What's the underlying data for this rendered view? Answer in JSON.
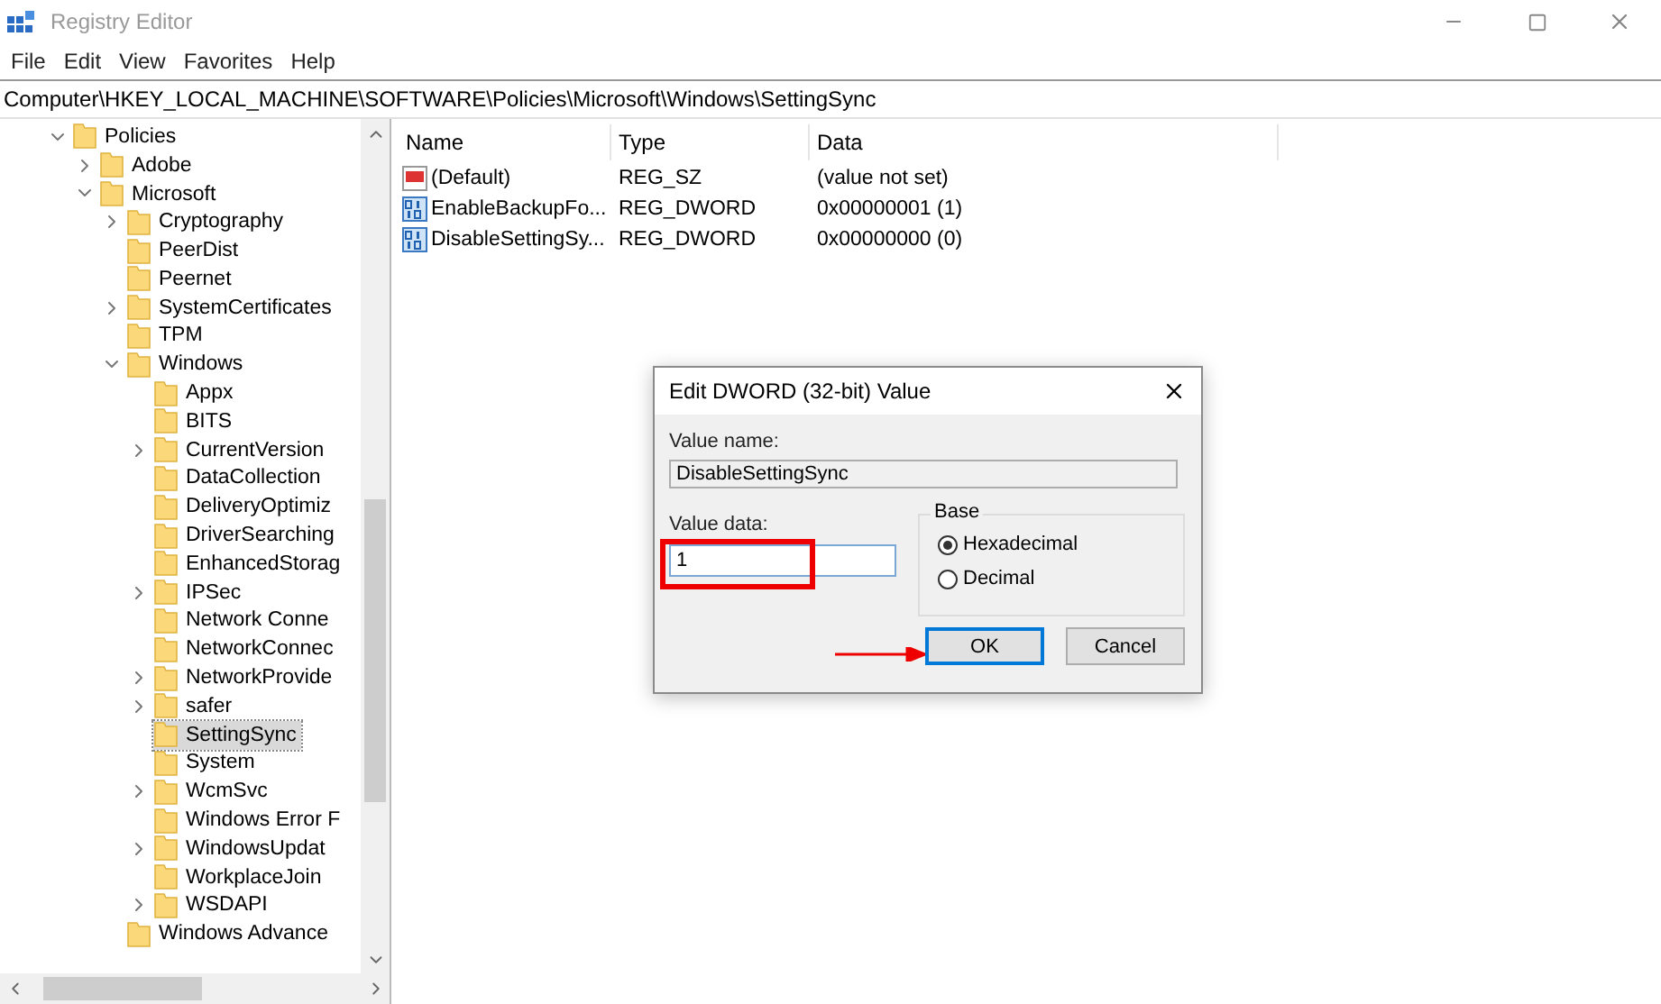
{
  "window": {
    "title": "Registry Editor"
  },
  "menu": [
    "File",
    "Edit",
    "View",
    "Favorites",
    "Help"
  ],
  "address": "Computer\\HKEY_LOCAL_MACHINE\\SOFTWARE\\Policies\\Microsoft\\Windows\\SettingSync",
  "tree": [
    {
      "label": "Policies",
      "expanded": true,
      "selected": false,
      "children": [
        {
          "label": "Adobe",
          "expanded": false,
          "selected": false
        },
        {
          "label": "Microsoft",
          "expanded": true,
          "selected": false,
          "children": [
            {
              "label": "Cryptography",
              "expanded": false,
              "selected": false
            },
            {
              "label": "PeerDist",
              "selected": false
            },
            {
              "label": "Peernet",
              "selected": false
            },
            {
              "label": "SystemCertificates",
              "expanded": false,
              "selected": false
            },
            {
              "label": "TPM",
              "selected": false
            },
            {
              "label": "Windows",
              "expanded": true,
              "selected": false,
              "children": [
                {
                  "label": "Appx",
                  "selected": false
                },
                {
                  "label": "BITS",
                  "selected": false
                },
                {
                  "label": "CurrentVersion",
                  "expanded": false,
                  "selected": false
                },
                {
                  "label": "DataCollection",
                  "selected": false
                },
                {
                  "label": "DeliveryOptimiz",
                  "selected": false
                },
                {
                  "label": "DriverSearching",
                  "selected": false
                },
                {
                  "label": "EnhancedStorag",
                  "selected": false
                },
                {
                  "label": "IPSec",
                  "expanded": false,
                  "selected": false
                },
                {
                  "label": "Network Conne",
                  "selected": false
                },
                {
                  "label": "NetworkConnec",
                  "selected": false
                },
                {
                  "label": "NetworkProvide",
                  "expanded": false,
                  "selected": false
                },
                {
                  "label": "safer",
                  "expanded": false,
                  "selected": false
                },
                {
                  "label": "SettingSync",
                  "selected": true
                },
                {
                  "label": "System",
                  "selected": false
                },
                {
                  "label": "WcmSvc",
                  "expanded": false,
                  "selected": false
                },
                {
                  "label": "Windows Error F",
                  "selected": false
                },
                {
                  "label": "WindowsUpdat",
                  "expanded": false,
                  "selected": false
                },
                {
                  "label": "WorkplaceJoin",
                  "selected": false
                },
                {
                  "label": "WSDAPI",
                  "expanded": false,
                  "selected": false
                }
              ]
            },
            {
              "label": "Windows Advance",
              "selected": false
            }
          ]
        }
      ]
    }
  ],
  "values": {
    "columns": [
      "Name",
      "Type",
      "Data"
    ],
    "rows": [
      {
        "kind": "string",
        "name": "(Default)",
        "type": "REG_SZ",
        "data": "(value not set)"
      },
      {
        "kind": "binary",
        "name": "EnableBackupFo...",
        "type": "REG_DWORD",
        "data": "0x00000001 (1)"
      },
      {
        "kind": "binary",
        "name": "DisableSettingSy...",
        "type": "REG_DWORD",
        "data": "0x00000000 (0)"
      }
    ]
  },
  "dialog": {
    "title": "Edit DWORD (32-bit) Value",
    "value_name_label": "Value name:",
    "value_name": "DisableSettingSync",
    "value_data_label": "Value data:",
    "value_data": "1",
    "base_label": "Base",
    "base_options": [
      {
        "label": "Hexadecimal",
        "selected": true
      },
      {
        "label": "Decimal",
        "selected": false
      }
    ],
    "buttons": [
      {
        "label": "OK",
        "default": true
      },
      {
        "label": "Cancel",
        "default": false
      }
    ]
  }
}
